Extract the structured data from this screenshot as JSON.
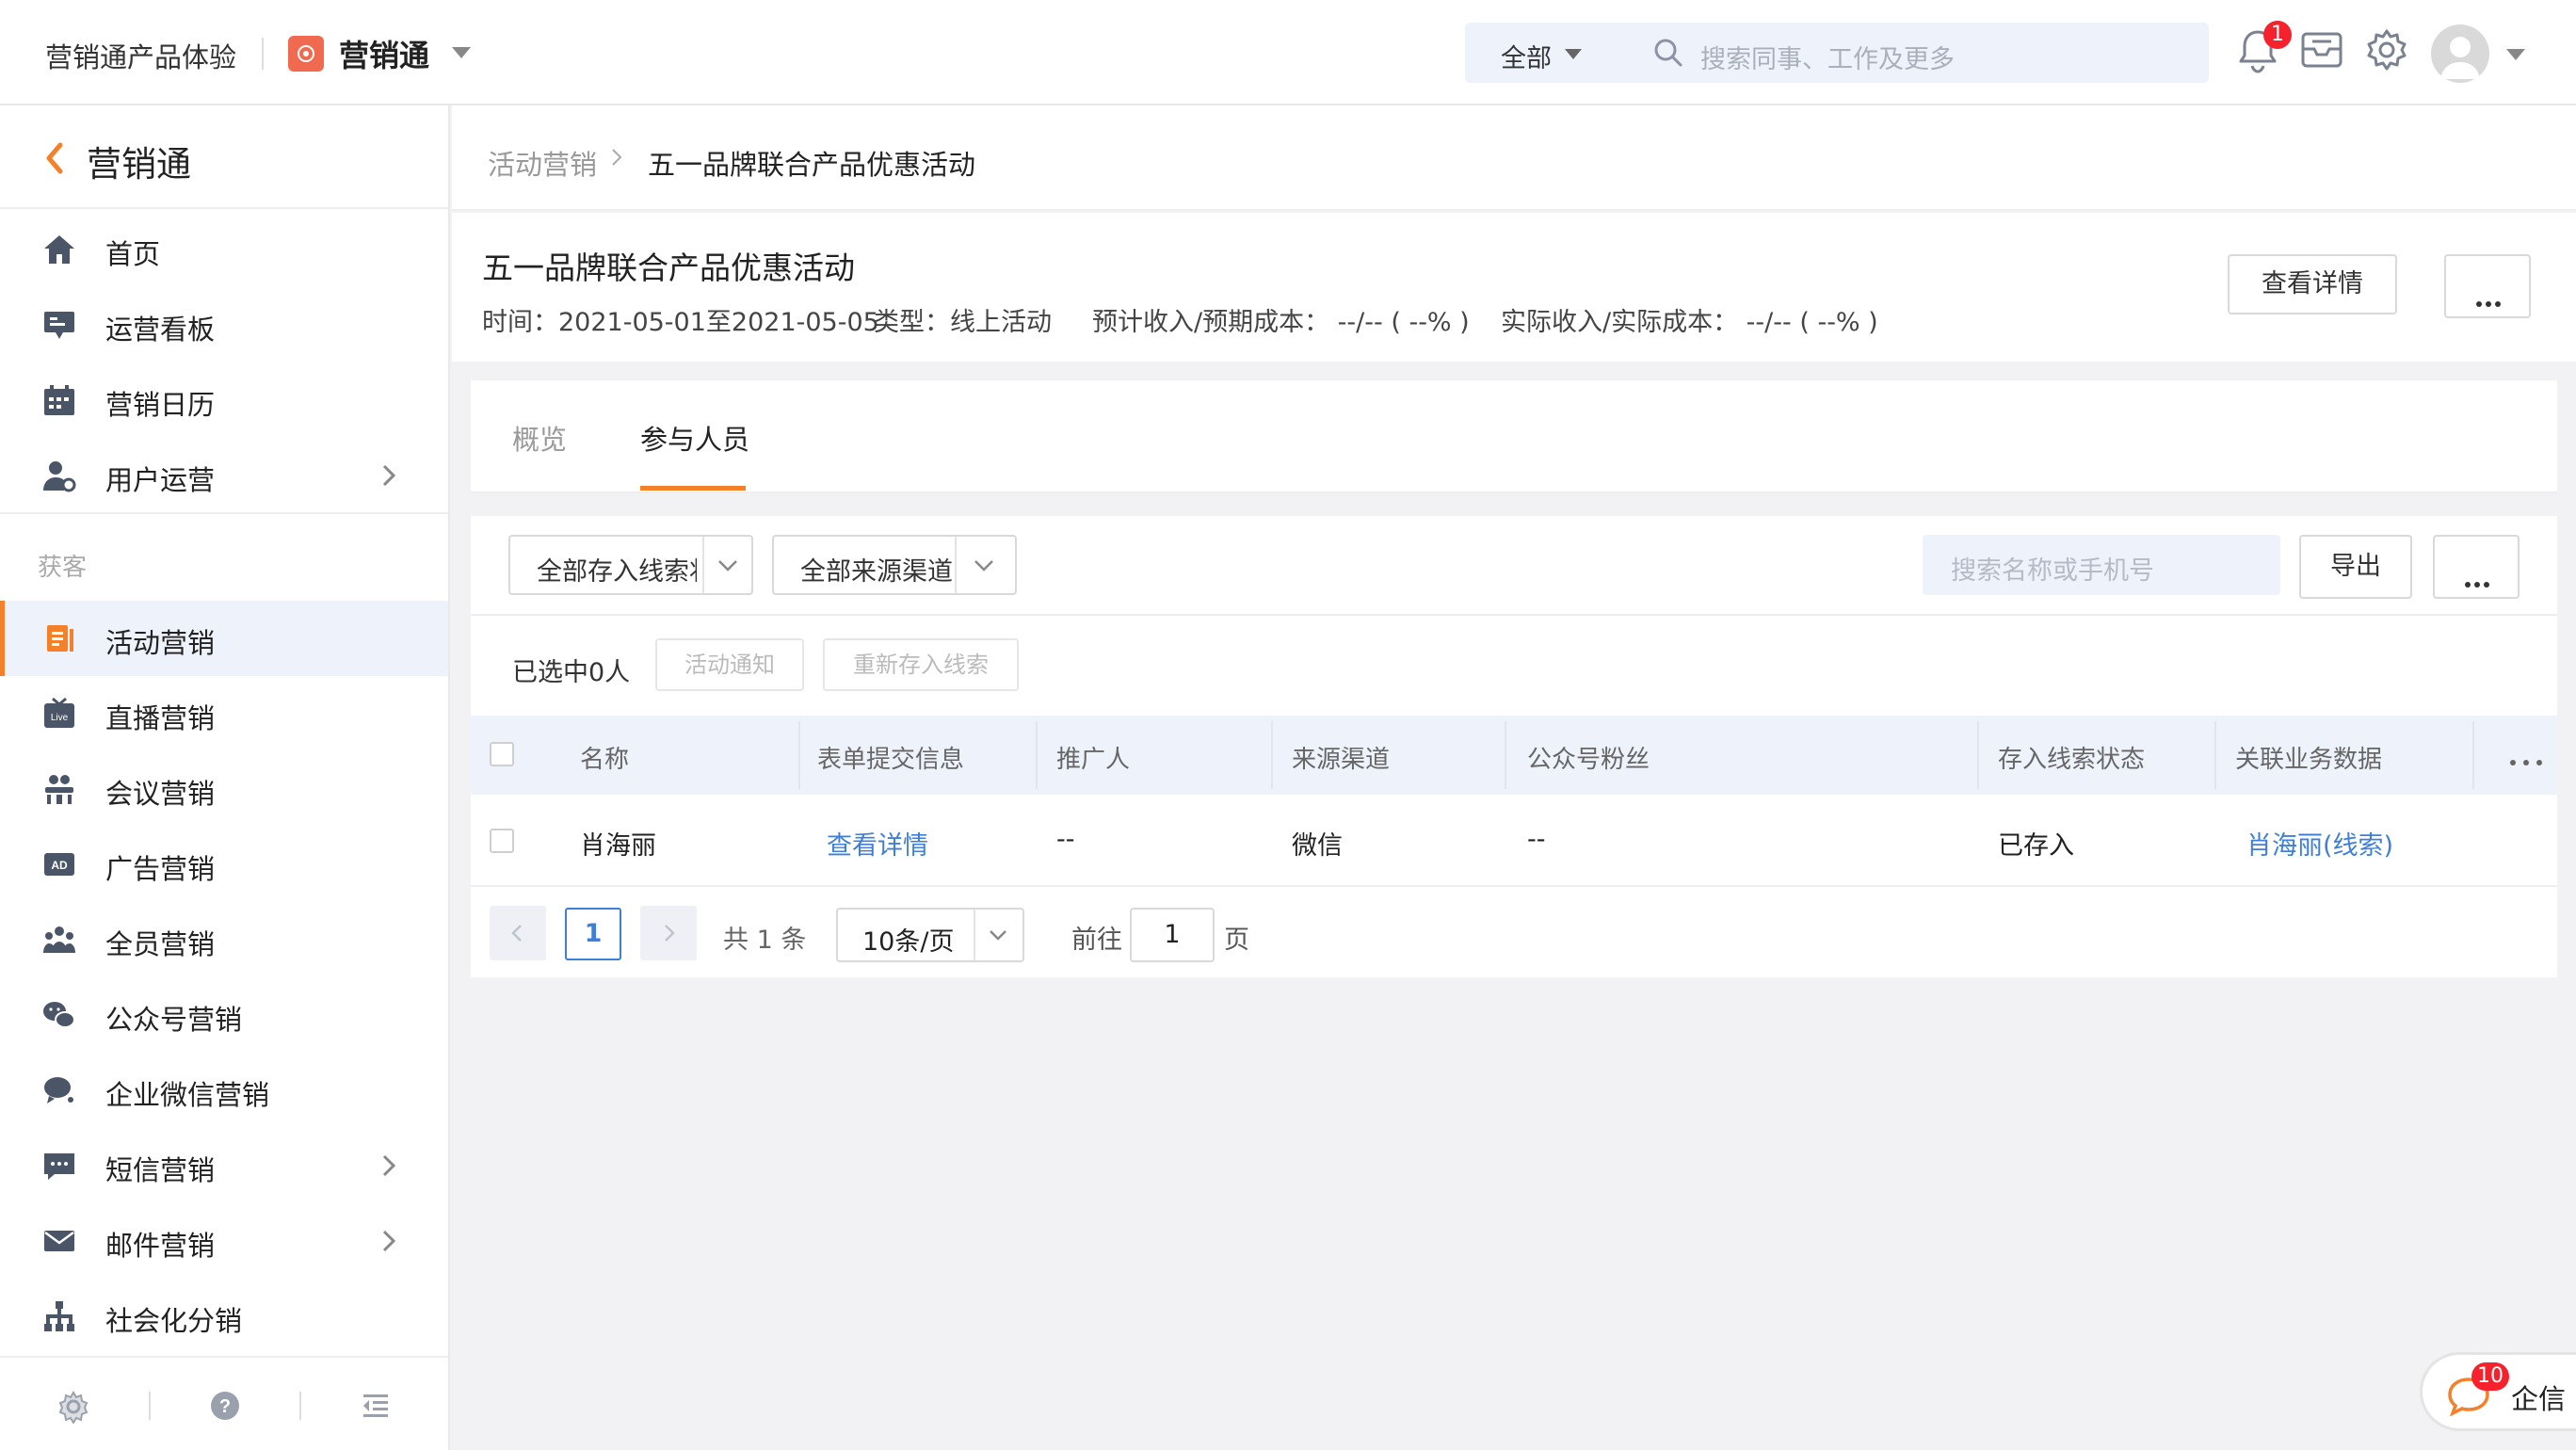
{
  "topbar": {
    "product_name": "营销通产品体验",
    "app_name": "营销通",
    "search_scope": "全部",
    "search_placeholder": "搜索同事、工作及更多",
    "notification_count": "1"
  },
  "sidebar": {
    "title": "营销通",
    "group_label": "获客",
    "items": [
      {
        "label": "首页",
        "icon": "home-icon"
      },
      {
        "label": "运营看板",
        "icon": "dashboard-icon"
      },
      {
        "label": "营销日历",
        "icon": "calendar-icon"
      },
      {
        "label": "用户运营",
        "icon": "user-ops-icon"
      },
      {
        "label": "活动营销",
        "icon": "activity-icon"
      },
      {
        "label": "直播营销",
        "icon": "live-icon"
      },
      {
        "label": "会议营销",
        "icon": "meeting-icon"
      },
      {
        "label": "广告营销",
        "icon": "ad-icon"
      },
      {
        "label": "全员营销",
        "icon": "team-icon"
      },
      {
        "label": "公众号营销",
        "icon": "wechat-icon"
      },
      {
        "label": "企业微信营销",
        "icon": "work-wechat-icon"
      },
      {
        "label": "短信营销",
        "icon": "sms-icon"
      },
      {
        "label": "邮件营销",
        "icon": "mail-icon"
      },
      {
        "label": "社会化分销",
        "icon": "distribution-icon"
      }
    ]
  },
  "breadcrumb": {
    "parent": "活动营销",
    "current": "五一品牌联合产品优惠活动"
  },
  "header": {
    "title": "五一品牌联合产品优惠活动",
    "time": "时间：2021-05-01至2021-05-05",
    "type": "类型：线上活动",
    "expected": "预计收入/预期成本：  --/-- ( --% )",
    "actual": "实际收入/实际成本：  --/-- ( --% )",
    "detail_button": "查看详情"
  },
  "tabs": [
    {
      "label": "概览",
      "active": false
    },
    {
      "label": "参与人员",
      "active": true
    }
  ],
  "filters": {
    "lead_status_select": "全部存入线索状态",
    "source_select": "全部来源渠道",
    "search_placeholder": "搜索名称或手机号",
    "export_button": "导出"
  },
  "selection": {
    "count_text": "已选中0人",
    "notify_button": "活动通知",
    "resave_button": "重新存入线索"
  },
  "table": {
    "columns": [
      "名称",
      "表单提交信息",
      "推广人",
      "来源渠道",
      "公众号粉丝",
      "存入线索状态",
      "关联业务数据"
    ],
    "rows": [
      {
        "name": "肖海丽",
        "form_info": "查看详情",
        "promoter": "--",
        "source": "微信",
        "fan": "--",
        "lead_status": "已存入",
        "related": "肖海丽(线索)"
      }
    ]
  },
  "pagination": {
    "current_page": "1",
    "total": "共 1 条",
    "page_size": "10条/页",
    "goto_label": "前往",
    "goto_value": "1",
    "page_unit": "页"
  },
  "qixin": {
    "label": "企信",
    "count": "10"
  },
  "colors": {
    "accent": "#f5802a",
    "link": "#3f7fd8",
    "badge": "#f5222d"
  }
}
